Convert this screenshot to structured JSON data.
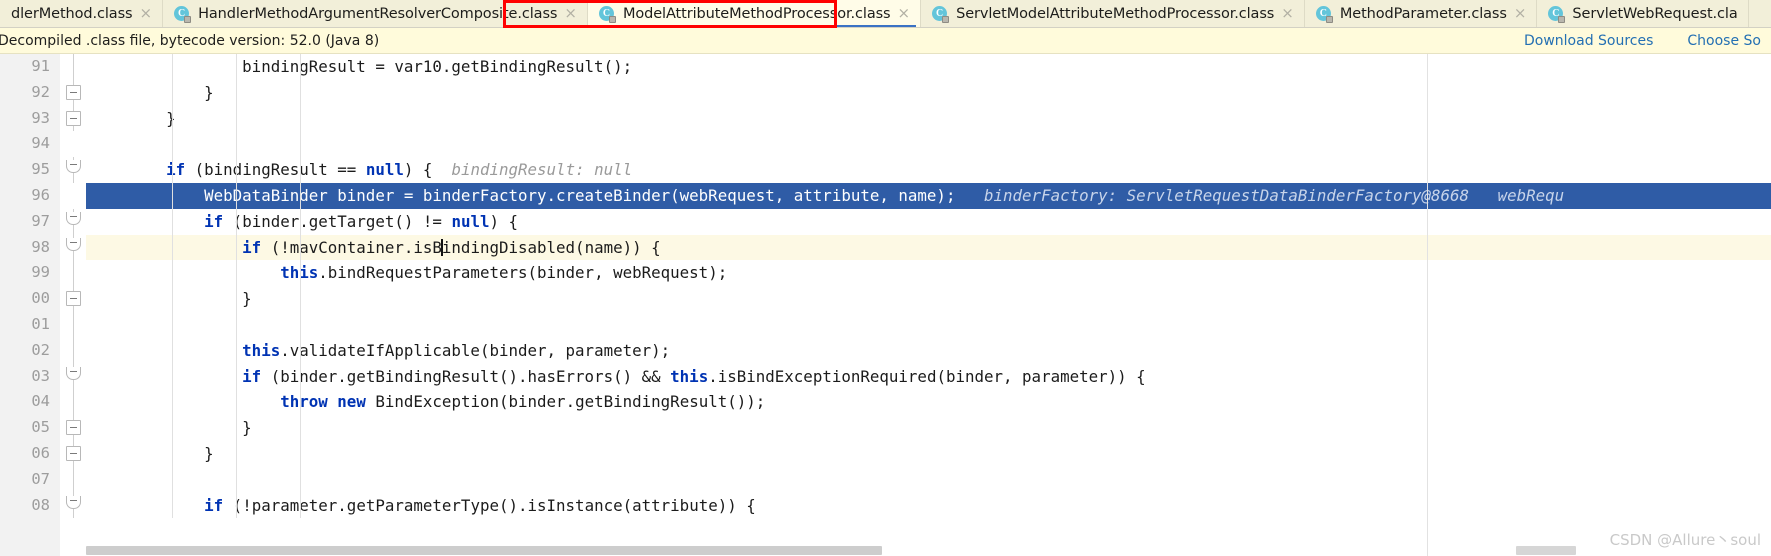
{
  "tabs": [
    {
      "label": "dlerMethod.class",
      "icon": "java-class-icon",
      "active": false,
      "truncated_left": true
    },
    {
      "label": "HandlerMethodArgumentResolverComposite.class",
      "icon": "java-class-icon",
      "active": false
    },
    {
      "label": "ModelAttributeMethodProcessor.class",
      "icon": "java-class-icon",
      "active": true
    },
    {
      "label": "ServletModelAttributeMethodProcessor.class",
      "icon": "java-class-icon",
      "active": false
    },
    {
      "label": "MethodParameter.class",
      "icon": "java-class-icon",
      "active": false
    },
    {
      "label": "ServletWebRequest.cla",
      "icon": "java-class-icon",
      "active": false,
      "truncated_right": true
    }
  ],
  "tab_close_glyph": "×",
  "class_icon_letter": "C",
  "highlight_color": "#ff0000",
  "banner": {
    "text": "Decompiled .class file, bytecode version: 52.0 (Java 8)",
    "links": [
      {
        "label": "Download Sources"
      },
      {
        "label": "Choose So"
      }
    ],
    "link_color": "#2470b3"
  },
  "editor": {
    "selected_line_number": "96",
    "caret_line_number": "98",
    "line_numbers": [
      "91",
      "92",
      "93",
      "94",
      "95",
      "96",
      "97",
      "98",
      "99",
      "00",
      "01",
      "02",
      "03",
      "04",
      "05",
      "06",
      "07",
      "08"
    ],
    "lines": [
      {
        "num": "91",
        "fold": "line",
        "segments": [
          {
            "t": "                bindingResult = var10.getBindingResult();",
            "c": ""
          }
        ]
      },
      {
        "num": "92",
        "fold": "end",
        "segments": [
          {
            "t": "            }",
            "c": ""
          }
        ]
      },
      {
        "num": "93",
        "fold": "end",
        "segments": [
          {
            "t": "        }",
            "c": ""
          }
        ]
      },
      {
        "num": "94",
        "fold": "none",
        "segments": [
          {
            "t": "",
            "c": ""
          }
        ]
      },
      {
        "num": "95",
        "fold": "endround",
        "segments": [
          {
            "t": "        ",
            "c": ""
          },
          {
            "t": "if",
            "c": "kw"
          },
          {
            "t": " (bindingResult == ",
            "c": ""
          },
          {
            "t": "null",
            "c": "kw"
          },
          {
            "t": ") {  ",
            "c": ""
          },
          {
            "t": "bindingResult: null",
            "c": "hint"
          }
        ]
      },
      {
        "num": "96",
        "fold": "none",
        "selected": true,
        "segments": [
          {
            "t": "            WebDataBinder binder = binderFactory.createBinder(webRequest, attribute, name);   ",
            "c": ""
          },
          {
            "t": "binderFactory: ServletRequestDataBinderFactory@8668   webRequ",
            "c": "hint"
          }
        ]
      },
      {
        "num": "97",
        "fold": "endround",
        "segments": [
          {
            "t": "            ",
            "c": ""
          },
          {
            "t": "if",
            "c": "kw"
          },
          {
            "t": " (binder.getTarget() != ",
            "c": ""
          },
          {
            "t": "null",
            "c": "kw"
          },
          {
            "t": ") {",
            "c": ""
          }
        ]
      },
      {
        "num": "98",
        "fold": "endround",
        "caret": true,
        "segments": [
          {
            "t": "                ",
            "c": ""
          },
          {
            "t": "if",
            "c": "kw"
          },
          {
            "t": " (!mavContainer.isB",
            "c": ""
          },
          {
            "t": "|CARET|",
            "c": "caret"
          },
          {
            "t": "indingDisabled(name)) {",
            "c": ""
          }
        ]
      },
      {
        "num": "99",
        "fold": "line",
        "segments": [
          {
            "t": "                    ",
            "c": ""
          },
          {
            "t": "this",
            "c": "kw"
          },
          {
            "t": ".bindRequestParameters(binder, webRequest);",
            "c": ""
          }
        ]
      },
      {
        "num": "00",
        "fold": "end",
        "segments": [
          {
            "t": "                }",
            "c": ""
          }
        ]
      },
      {
        "num": "01",
        "fold": "line",
        "segments": [
          {
            "t": "",
            "c": ""
          }
        ]
      },
      {
        "num": "02",
        "fold": "line",
        "segments": [
          {
            "t": "                ",
            "c": ""
          },
          {
            "t": "this",
            "c": "kw"
          },
          {
            "t": ".validateIfApplicable(binder, parameter);",
            "c": ""
          }
        ]
      },
      {
        "num": "03",
        "fold": "endround",
        "segments": [
          {
            "t": "                ",
            "c": ""
          },
          {
            "t": "if",
            "c": "kw"
          },
          {
            "t": " (binder.getBindingResult().hasErrors() && ",
            "c": ""
          },
          {
            "t": "this",
            "c": "kw"
          },
          {
            "t": ".isBindExceptionRequired(binder, parameter)) {",
            "c": ""
          }
        ]
      },
      {
        "num": "04",
        "fold": "line",
        "segments": [
          {
            "t": "                    ",
            "c": ""
          },
          {
            "t": "throw",
            "c": "kw"
          },
          {
            "t": " ",
            "c": ""
          },
          {
            "t": "new",
            "c": "kw"
          },
          {
            "t": " BindException(binder.getBindingResult());",
            "c": ""
          }
        ]
      },
      {
        "num": "05",
        "fold": "end",
        "segments": [
          {
            "t": "                }",
            "c": ""
          }
        ]
      },
      {
        "num": "06",
        "fold": "end",
        "segments": [
          {
            "t": "            }",
            "c": ""
          }
        ]
      },
      {
        "num": "07",
        "fold": "line",
        "segments": [
          {
            "t": "",
            "c": ""
          }
        ]
      },
      {
        "num": "08",
        "fold": "endround",
        "segments": [
          {
            "t": "            ",
            "c": ""
          },
          {
            "t": "if",
            "c": "kw"
          },
          {
            "t": " (!parameter.getParameterType().isInstance(attribute)) {",
            "c": ""
          }
        ]
      }
    ],
    "selection_color": "#2f5ca6",
    "caret_line_color": "#fdf9e4",
    "keyword_color": "#0033b3",
    "hint_color": "#9a9a9a"
  },
  "watermark": "CSDN @Allure丶soul"
}
